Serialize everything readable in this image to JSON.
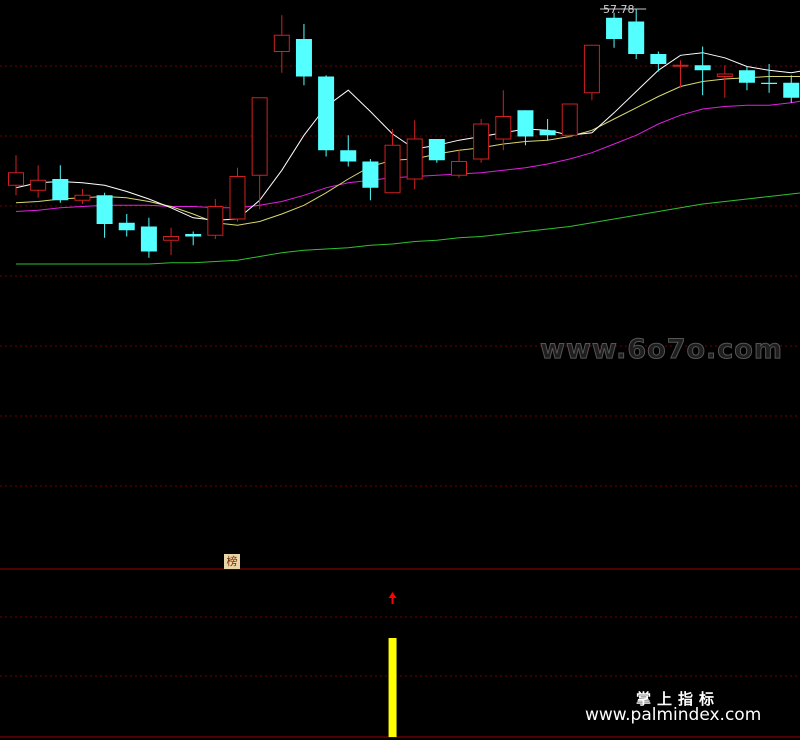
{
  "chart_data": {
    "type": "candlestick",
    "max_label": "57.78",
    "badge_text": "榜",
    "candles": [
      {
        "o": 43.6,
        "c": 44.6,
        "h": 46.0,
        "l": 42.8
      },
      {
        "o": 43.2,
        "c": 44.0,
        "h": 45.2,
        "l": 42.6
      },
      {
        "o": 44.1,
        "c": 42.4,
        "h": 45.2,
        "l": 42.2
      },
      {
        "o": 42.4,
        "c": 42.8,
        "h": 43.3,
        "l": 42.1
      },
      {
        "o": 42.8,
        "c": 40.5,
        "h": 43.0,
        "l": 39.4
      },
      {
        "o": 40.6,
        "c": 40.0,
        "h": 41.3,
        "l": 39.5
      },
      {
        "o": 40.3,
        "c": 38.3,
        "h": 41.0,
        "l": 37.8
      },
      {
        "o": 39.2,
        "c": 39.5,
        "h": 40.2,
        "l": 38.0
      },
      {
        "o": 39.7,
        "c": 39.5,
        "h": 39.9,
        "l": 38.8
      },
      {
        "o": 39.6,
        "c": 41.9,
        "h": 42.5,
        "l": 39.3
      },
      {
        "o": 40.9,
        "c": 44.3,
        "h": 45.0,
        "l": 40.7
      },
      {
        "o": 44.4,
        "c": 50.6,
        "h": 50.6,
        "l": 41.7
      },
      {
        "o": 54.3,
        "c": 55.6,
        "h": 57.2,
        "l": 52.6
      },
      {
        "o": 55.3,
        "c": 52.3,
        "h": 56.5,
        "l": 51.6
      },
      {
        "o": 52.3,
        "c": 46.4,
        "h": 52.4,
        "l": 45.9
      },
      {
        "o": 46.4,
        "c": 45.5,
        "h": 47.6,
        "l": 45.1
      },
      {
        "o": 45.5,
        "c": 43.4,
        "h": 45.7,
        "l": 42.4
      },
      {
        "o": 43.0,
        "c": 46.8,
        "h": 48.1,
        "l": 43.0
      },
      {
        "o": 44.1,
        "c": 47.3,
        "h": 48.8,
        "l": 43.3
      },
      {
        "o": 47.3,
        "c": 45.6,
        "h": 47.3,
        "l": 45.4
      },
      {
        "o": 44.4,
        "c": 45.5,
        "h": 46.4,
        "l": 44.2
      },
      {
        "o": 45.7,
        "c": 48.5,
        "h": 48.9,
        "l": 45.4
      },
      {
        "o": 47.3,
        "c": 49.1,
        "h": 51.2,
        "l": 46.4
      },
      {
        "o": 49.6,
        "c": 47.5,
        "h": 49.6,
        "l": 46.8
      },
      {
        "o": 48.0,
        "c": 47.6,
        "h": 48.9,
        "l": 47.2
      },
      {
        "o": 47.6,
        "c": 50.1,
        "h": 50.1,
        "l": 47.4
      },
      {
        "o": 51.0,
        "c": 54.8,
        "h": 54.8,
        "l": 50.4
      },
      {
        "o": 57.0,
        "c": 55.3,
        "h": 57.4,
        "l": 54.6
      },
      {
        "o": 56.7,
        "c": 54.1,
        "h": 57.7,
        "l": 53.7
      },
      {
        "o": 54.1,
        "c": 53.3,
        "h": 54.3,
        "l": 52.7
      },
      {
        "o": 53.2,
        "c": 53.2,
        "h": 53.6,
        "l": 51.4
      },
      {
        "o": 53.2,
        "c": 52.8,
        "h": 54.7,
        "l": 50.8
      },
      {
        "o": 52.3,
        "c": 52.5,
        "h": 53.2,
        "l": 50.6
      },
      {
        "o": 52.8,
        "c": 51.8,
        "h": 53.1,
        "l": 51.2
      },
      {
        "o": 51.8,
        "c": 51.7,
        "h": 53.3,
        "l": 51.0
      },
      {
        "o": 51.8,
        "c": 50.6,
        "h": 52.4,
        "l": 50.2
      },
      {
        "o": 50.6,
        "c": 51.8,
        "h": 51.8,
        "l": 49.5
      },
      {
        "o": 51.0,
        "c": 53.9,
        "h": 56.0,
        "l": 49.7
      }
    ],
    "ma_short": [
      43.4,
      43.8,
      43.9,
      43.8,
      43.6,
      43.1,
      42.5,
      41.8,
      41.0,
      40.8,
      40.9,
      42.4,
      44.8,
      47.6,
      49.9,
      51.2,
      49.5,
      47.7,
      46.5,
      46.8,
      47.2,
      47.5,
      47.8,
      48.1,
      48.0,
      47.6,
      47.8,
      49.4,
      51.1,
      52.8,
      54.0,
      54.2,
      53.8,
      53.1,
      52.8,
      52.6,
      52.9,
      53.1
    ],
    "ma_mid": [
      42.2,
      42.3,
      42.5,
      42.6,
      42.7,
      42.6,
      42.3,
      41.9,
      41.3,
      40.6,
      40.4,
      40.7,
      41.3,
      42.0,
      43.0,
      44.1,
      45.1,
      45.6,
      45.7,
      46.1,
      46.4,
      46.6,
      46.9,
      47.1,
      47.2,
      47.5,
      48.0,
      48.9,
      49.8,
      50.7,
      51.5,
      51.9,
      52.1,
      52.2,
      52.3,
      52.3,
      52.3,
      52.5
    ],
    "ma_long": [
      41.5,
      41.6,
      41.8,
      41.9,
      42.0,
      42.0,
      42.0,
      41.9,
      41.9,
      41.8,
      41.8,
      42.0,
      42.3,
      42.8,
      43.4,
      43.8,
      44.0,
      44.2,
      44.3,
      44.4,
      44.5,
      44.6,
      44.8,
      45.0,
      45.3,
      45.7,
      46.2,
      46.9,
      47.6,
      48.5,
      49.2,
      49.7,
      49.9,
      50.0,
      50.0,
      50.2,
      50.5,
      50.8
    ],
    "ma_year": [
      37.3,
      37.3,
      37.3,
      37.3,
      37.3,
      37.3,
      37.3,
      37.4,
      37.4,
      37.5,
      37.6,
      37.9,
      38.2,
      38.4,
      38.5,
      38.6,
      38.8,
      38.9,
      39.1,
      39.2,
      39.4,
      39.5,
      39.7,
      39.9,
      40.1,
      40.3,
      40.6,
      40.9,
      41.2,
      41.5,
      41.8,
      42.1,
      42.3,
      42.5,
      42.7,
      42.9,
      43.1,
      43.3
    ],
    "signal_index": 17,
    "signal_bar_value": 1
  },
  "watermark": {
    "top": "www.6o7o.com",
    "title": "掌上指标",
    "site": "www.palmindex.com"
  },
  "colors": {
    "up": "#d02020",
    "down": "#54ffff",
    "ma_short": "#ffffff",
    "ma_mid": "#d8d870",
    "ma_long": "#e020e0",
    "ma_year": "#30c030",
    "grid": "#700000",
    "signal": "#ffff00",
    "arrow": "#ff0000"
  }
}
